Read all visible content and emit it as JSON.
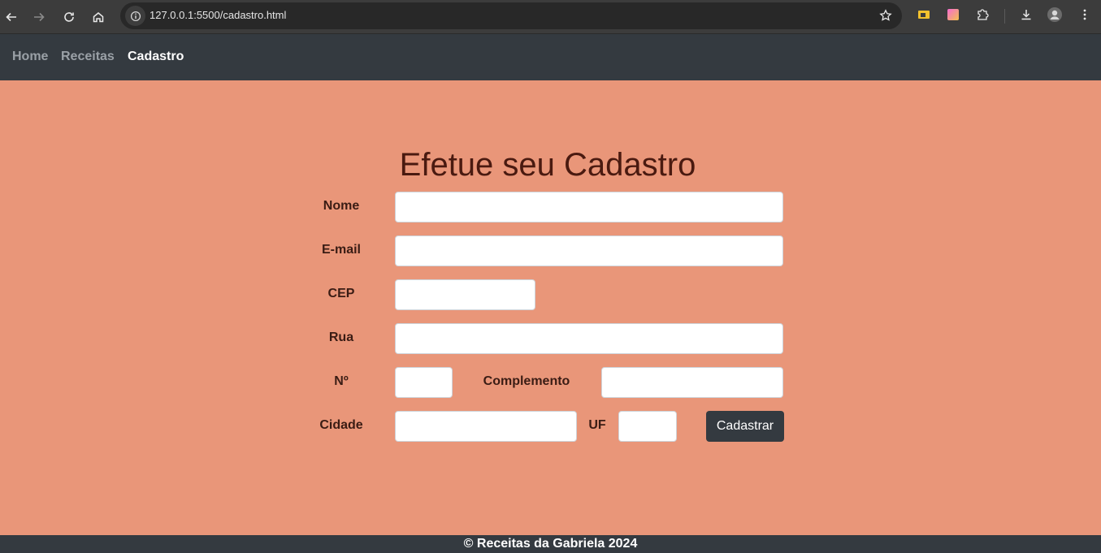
{
  "browser": {
    "url": "127.0.0.1:5500/cadastro.html",
    "icons": [
      "back-icon",
      "forward-icon",
      "reload-icon",
      "home-icon",
      "site-info-icon",
      "bookmark-star-icon",
      "extension-folder-icon",
      "extension-gradient-icon",
      "extensions-puzzle-icon",
      "download-icon",
      "profile-avatar-icon",
      "menu-kebab-icon"
    ]
  },
  "nav": {
    "items": [
      {
        "label": "Home",
        "active": false
      },
      {
        "label": "Receitas",
        "active": false
      },
      {
        "label": "Cadastro",
        "active": true
      }
    ]
  },
  "form": {
    "title": "Efetue seu Cadastro",
    "fields": {
      "nome": {
        "label": "Nome",
        "value": ""
      },
      "email": {
        "label": "E-mail",
        "value": ""
      },
      "cep": {
        "label": "CEP",
        "value": ""
      },
      "rua": {
        "label": "Rua",
        "value": ""
      },
      "numero": {
        "label": "Nº",
        "value": ""
      },
      "complemento": {
        "label": "Complemento",
        "value": ""
      },
      "cidade": {
        "label": "Cidade",
        "value": ""
      },
      "uf": {
        "label": "UF",
        "value": ""
      }
    },
    "submit_label": "Cadastrar"
  },
  "footer": {
    "text": "© Receitas da Gabriela 2024"
  },
  "colors": {
    "page_bg": "#e99679",
    "navbar_bg": "#343a40",
    "title_text": "#4a1a10",
    "button_bg": "#343a40"
  }
}
